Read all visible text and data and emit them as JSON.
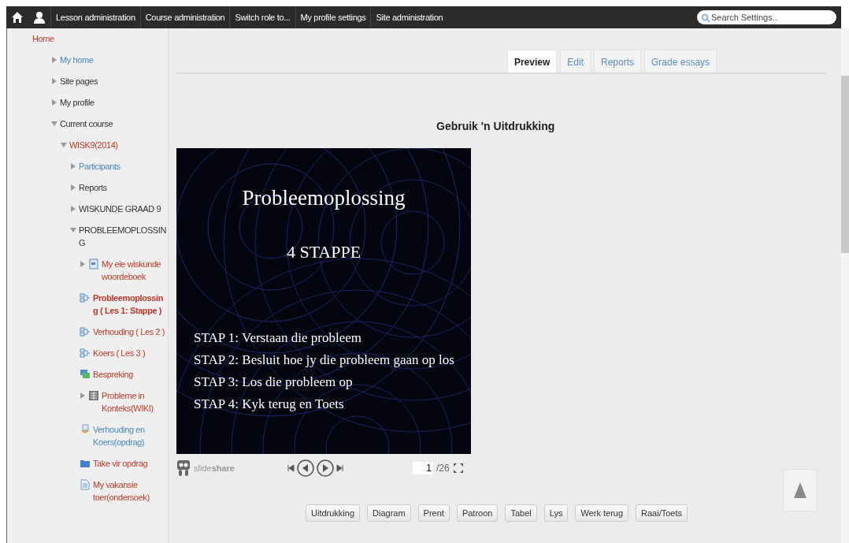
{
  "navbar": {
    "items": [
      "Lesson administration",
      "Course administration",
      "Switch role to...",
      "My profile settings",
      "Site administration"
    ],
    "search": {
      "placeholder": "Search Settings.."
    }
  },
  "sidebar": {
    "tree": [
      {
        "label": "Home",
        "color": "#c0392b",
        "children": [
          {
            "label": "My home",
            "color": "#4a86c5",
            "expanded": false
          },
          {
            "label": "Site pages",
            "color": "#333333",
            "expanded": false
          },
          {
            "label": "My profile",
            "color": "#333333",
            "expanded": false
          },
          {
            "label": "Current course",
            "color": "#333333",
            "expanded": true,
            "children": [
              {
                "label": "WISK9(2014)",
                "color": "#c0392b",
                "expanded": true,
                "children": [
                  {
                    "label": "Participants",
                    "color": "#4a86c5",
                    "expanded": false
                  },
                  {
                    "label": "Reports",
                    "color": "#333333",
                    "expanded": false
                  },
                  {
                    "label": "WISKUNDE GRAAD 9",
                    "color": "#333333",
                    "expanded": false
                  },
                  {
                    "label": "PROBLEEMOPLOSSING",
                    "color": "#333333",
                    "expanded": true,
                    "children": [
                      {
                        "label": "My eie wiskunde woordeboek",
                        "kind": "glossary",
                        "color": "#c0392b",
                        "expanded": false,
                        "selected": false
                      },
                      {
                        "label": "Probleemoplossing ( Les 1: Stappe )",
                        "kind": "lesson",
                        "color": "#c0392b",
                        "selected": true
                      },
                      {
                        "label": "Verhouding ( Les 2 )",
                        "kind": "lesson",
                        "color": "#c0392b",
                        "selected": false
                      },
                      {
                        "label": "Koers ( Les 3 )",
                        "kind": "lesson",
                        "color": "#c0392b",
                        "selected": false
                      },
                      {
                        "label": "Bespreking",
                        "kind": "forum",
                        "color": "#c0392b",
                        "selected": false
                      },
                      {
                        "label": "Probleme in Konteks(WIKI)",
                        "kind": "wiki",
                        "color": "#c0392b",
                        "expanded": false,
                        "selected": false
                      },
                      {
                        "label": "Verhouding en Koers(opdrag)",
                        "kind": "assign",
                        "color": "#4a86c5",
                        "selected": false
                      },
                      {
                        "label": "Take vir opdrag",
                        "kind": "folder",
                        "color": "#c0392b",
                        "selected": false
                      },
                      {
                        "label": "My vakansie toer(ondersoek)",
                        "kind": "page",
                        "color": "#c0392b",
                        "selected": false
                      }
                    ]
                  }
                ]
              }
            ]
          }
        ]
      }
    ]
  },
  "tabs": [
    {
      "label": "Preview",
      "selected": true
    },
    {
      "label": "Edit",
      "selected": false
    },
    {
      "label": "Reports",
      "selected": false
    },
    {
      "label": "Grade essays",
      "selected": false
    }
  ],
  "heading": "Gebruik 'n Uitdrukking",
  "slide": {
    "title": "Probleemoplossing",
    "subtitle": "4 STAPPE",
    "lines": [
      "STAP 1: Verstaan die probleem",
      "STAP 2: Besluit hoe jy die probleem gaan op los",
      "STAP 3: Los die probleem op",
      "STAP 4: Kyk terug en Toets"
    ]
  },
  "player": {
    "brand": "slide**share**",
    "page": "1",
    "total": "/26"
  },
  "buttons": [
    "Uitdrukking",
    "Diagram",
    "Prent",
    "Patroon",
    "Tabel",
    "Lys",
    "Werk terug",
    "Raai/Toets"
  ]
}
